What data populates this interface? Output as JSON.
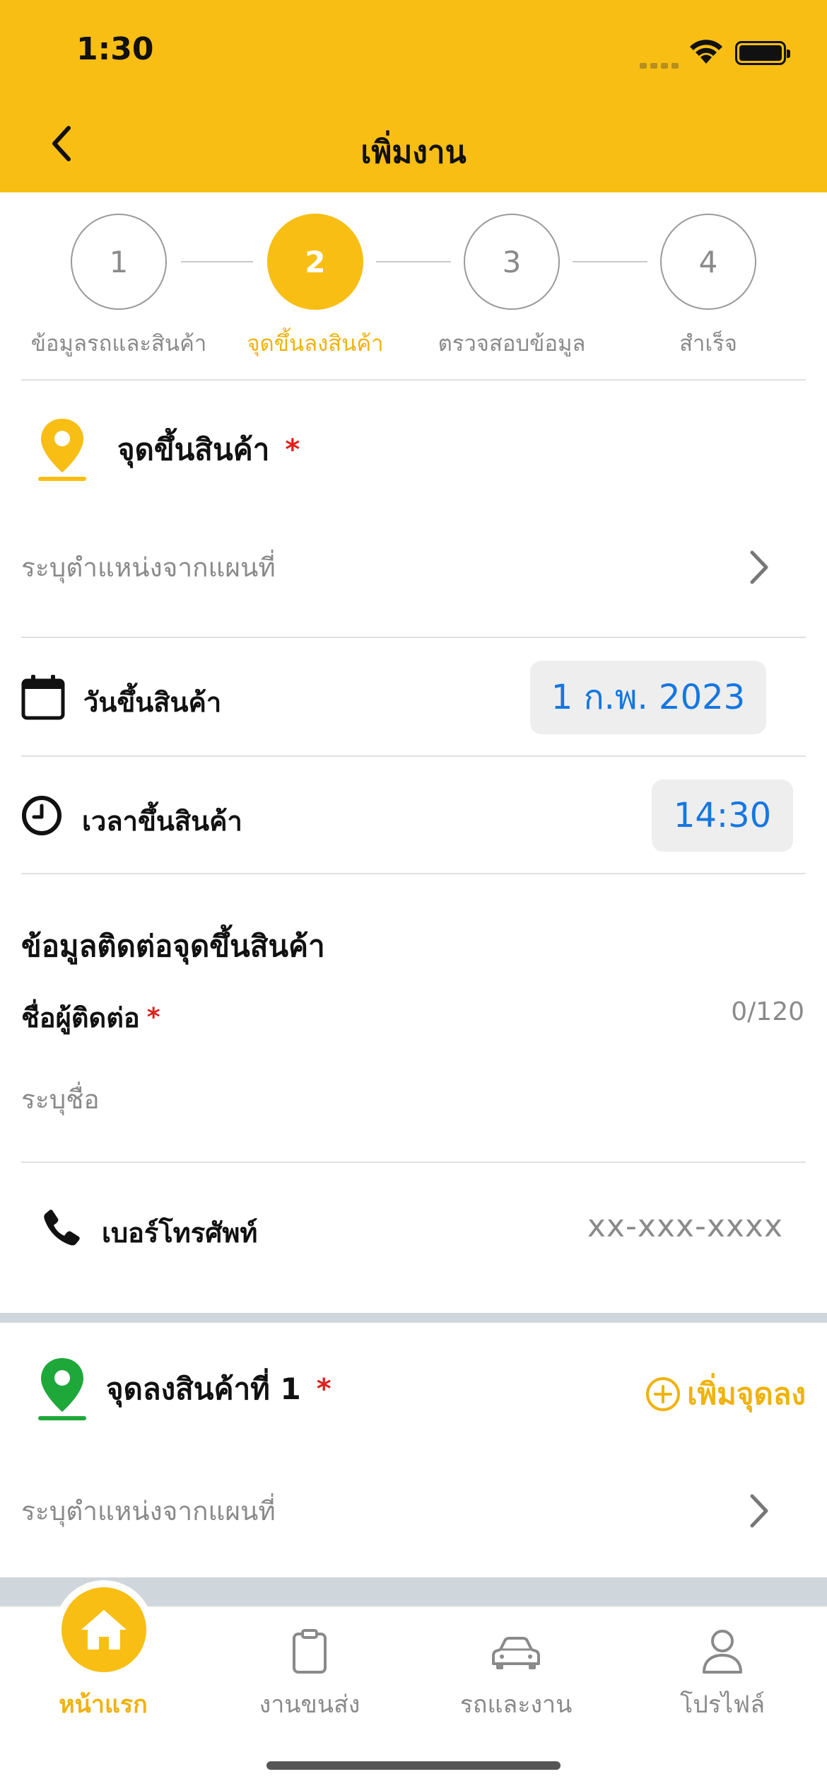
{
  "status": {
    "time": "1:30"
  },
  "nav": {
    "title": "เพิ่มงาน"
  },
  "stepper": {
    "steps": [
      {
        "number": "1",
        "label": "ข้อมูลรถและสินค้า"
      },
      {
        "number": "2",
        "label": "จุดขึ้นลงสินค้า"
      },
      {
        "number": "3",
        "label": "ตรวจสอบข้อมูล"
      },
      {
        "number": "4",
        "label": "สำเร็จ"
      }
    ],
    "active_index": 1
  },
  "pickup": {
    "title": "จุดขึ้นสินค้า",
    "required_mark": "*",
    "map_placeholder": "ระบุตำแหน่งจากแผนที่",
    "date_label": "วันขึ้นสินค้า",
    "date_value": "1 ก.พ. 2023",
    "time_label": "เวลาขึ้นสินค้า",
    "time_value": "14:30",
    "contact_title": "ข้อมูลติดต่อจุดขึ้นสินค้า",
    "contact_name_label": "ชื่อผู้ติดต่อ",
    "contact_name_counter": "0/120",
    "contact_name_placeholder": "ระบุชื่อ",
    "phone_label": "เบอร์โทรศัพท์",
    "phone_placeholder": "xx-xxx-xxxx"
  },
  "dropoff": {
    "title": "จุดลงสินค้าที่ 1",
    "required_mark": "*",
    "add_label": "เพิ่มจุดลง",
    "map_placeholder": "ระบุตำแหน่งจากแผนที่"
  },
  "tabs": [
    {
      "label": "หน้าแรก",
      "icon": "home-icon"
    },
    {
      "label": "งานขนส่ง",
      "icon": "clipboard-icon"
    },
    {
      "label": "รถและงาน",
      "icon": "car-icon"
    },
    {
      "label": "โปรไฟล์",
      "icon": "profile-icon"
    }
  ],
  "colors": {
    "brand_yellow": "#F8BE14",
    "active_text": "#F0B20E",
    "required_red": "#E02020",
    "chip_text_blue": "#1577E0",
    "pickup_pin": "#F8BE14",
    "dropoff_pin": "#1FA83A"
  }
}
